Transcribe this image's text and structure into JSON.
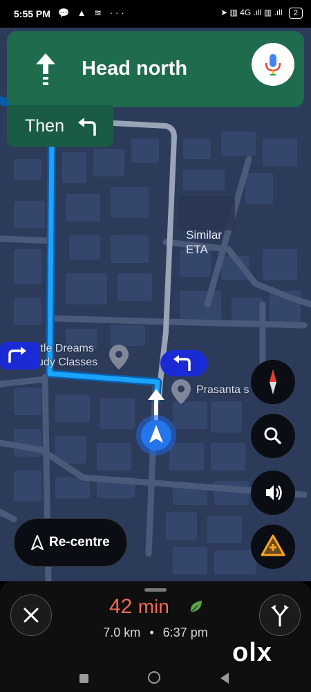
{
  "status_bar": {
    "time": "5:55 PM",
    "left_icons": "💬 ▲ ≋  ···",
    "right_icons": "➤ ▥ 4G .ıll ▥ .ıll",
    "battery": "2"
  },
  "navigation": {
    "instruction": "Head north",
    "then_label": "Then",
    "mic_icon": "mic-icon"
  },
  "map": {
    "labels": {
      "poi_left_line1": "ttle Dreams",
      "poi_left_line2": "udy Classes",
      "poi_right": "Prasanta s",
      "alt_route_line1": "Similar",
      "alt_route_line2": "ETA"
    },
    "route_color": "#1aa3ff",
    "alt_route_color": "#9aa4b8"
  },
  "controls": {
    "compass": "compass-icon",
    "search": "search-icon",
    "sound": "sound-icon",
    "report": "report-incident-icon",
    "recentre_label": "Re-centre"
  },
  "trip": {
    "duration": "42",
    "duration_unit": "min",
    "distance": "7.0 km",
    "separator": "•",
    "arrival": "6:37 pm",
    "eta_color": "#f26b5b"
  },
  "watermark": "olx"
}
